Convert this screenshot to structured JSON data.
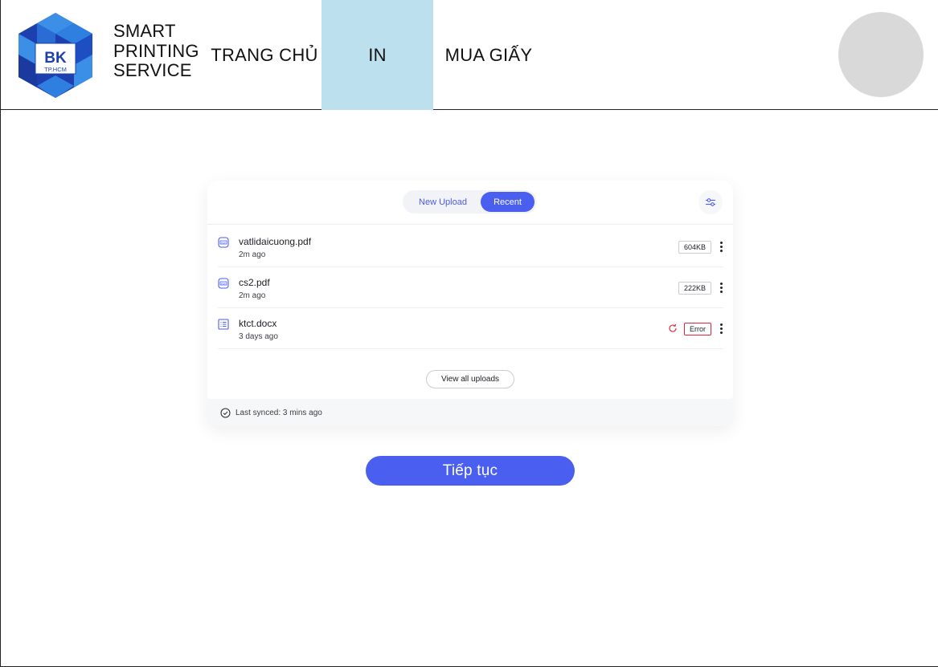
{
  "brand": {
    "logo_text": "BK",
    "logo_subtext": "TP.HCM",
    "line1": "SMART",
    "line2": "PRINTING",
    "line3": "SERVICE"
  },
  "nav": {
    "home": "TRANG CHỦ",
    "print": "IN",
    "buy_paper": "MUA GIẤY",
    "active": "IN",
    "active_color": "#bde0ee"
  },
  "upload_panel": {
    "tabs": {
      "new_upload": "New Upload",
      "recent": "Recent",
      "selected": "Recent"
    },
    "filter_icon": "sliders-icon",
    "files": [
      {
        "name": "vatlidaicuong.pdf",
        "time": "2m ago",
        "size": "604KB",
        "icon": "pdf-file-icon"
      },
      {
        "name": "cs2.pdf",
        "time": "2m ago",
        "size": "222KB",
        "icon": "pdf-file-icon"
      },
      {
        "name": "ktct.docx",
        "time": "3 days ago",
        "status": "Error",
        "icon": "doc-file-icon"
      }
    ],
    "view_all": "View all uploads",
    "last_synced": "Last synced: 3 mins ago"
  },
  "continue_button": "Tiếp tục",
  "colors": {
    "accent": "#4a5ef0",
    "error": "#e0253a",
    "avatar": "#d9d9d9"
  }
}
